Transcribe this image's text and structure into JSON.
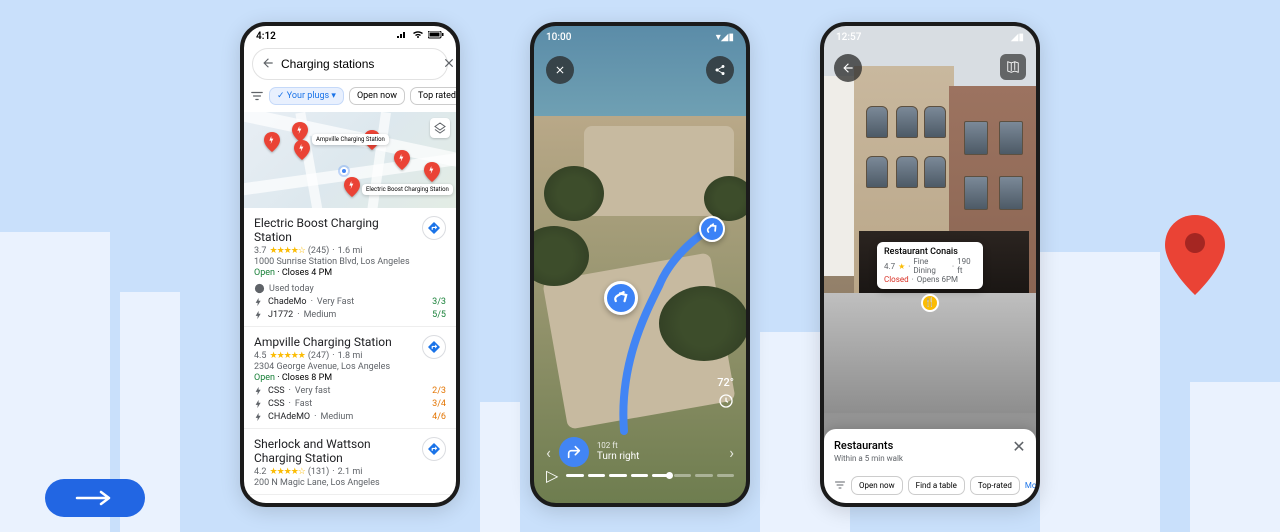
{
  "phone1": {
    "status_time": "4:12",
    "search_value": "Charging stations",
    "filters": {
      "your_plugs": "Your plugs",
      "open_now": "Open now",
      "top_rated": "Top rated"
    },
    "map_labels": {
      "ampville": "Ampville Charging\nStation",
      "electric": "Electric Boost\nCharging Station"
    },
    "stations": [
      {
        "name": "Electric Boost Charging Station",
        "rating": "3.7",
        "reviews": "(245)",
        "distance": "1.6 mi",
        "address": "1000 Sunrise Station Blvd, Los Angeles",
        "status": "Open",
        "hours": "Closes 4 PM",
        "used_label": "Used today",
        "plugs": [
          {
            "name": "ChadeMo",
            "speed": "Very Fast",
            "count": "3/3",
            "cls": "g"
          },
          {
            "name": "J1772",
            "speed": "Medium",
            "count": "5/5",
            "cls": "g"
          }
        ]
      },
      {
        "name": "Ampville Charging Station",
        "rating": "4.5",
        "reviews": "(247)",
        "distance": "1.8 mi",
        "address": "2304 George Avenue, Los Angeles",
        "status": "Open",
        "hours": "Closes 8 PM",
        "plugs": [
          {
            "name": "CSS",
            "speed": "Very fast",
            "count": "2/3",
            "cls": "o"
          },
          {
            "name": "CSS",
            "speed": "Fast",
            "count": "3/4",
            "cls": "o"
          },
          {
            "name": "CHAdeMO",
            "speed": "Medium",
            "count": "4/6",
            "cls": "o"
          }
        ]
      },
      {
        "name": "Sherlock and Wattson Charging Station",
        "rating": "4.2",
        "reviews": "(131)",
        "distance": "2.1 mi",
        "address": "200 N Magic Lane, Los Angeles"
      }
    ]
  },
  "phone2": {
    "status_time": "10:00",
    "temperature": "72°",
    "direction": {
      "distance": "102 ft",
      "instruction": "Turn right"
    }
  },
  "phone3": {
    "status_time": "12:57",
    "poi": {
      "name": "Restaurant Conais",
      "rating": "4.7",
      "category": "Fine Dining",
      "distance": "190 ft",
      "status": "Closed",
      "opens": "Opens 6PM"
    },
    "sheet": {
      "title": "Restaurants",
      "subtitle": "Within a 5 min walk",
      "chips": {
        "open_now": "Open now",
        "find_table": "Find a table",
        "top_rated": "Top-rated",
        "more": "More"
      }
    }
  }
}
